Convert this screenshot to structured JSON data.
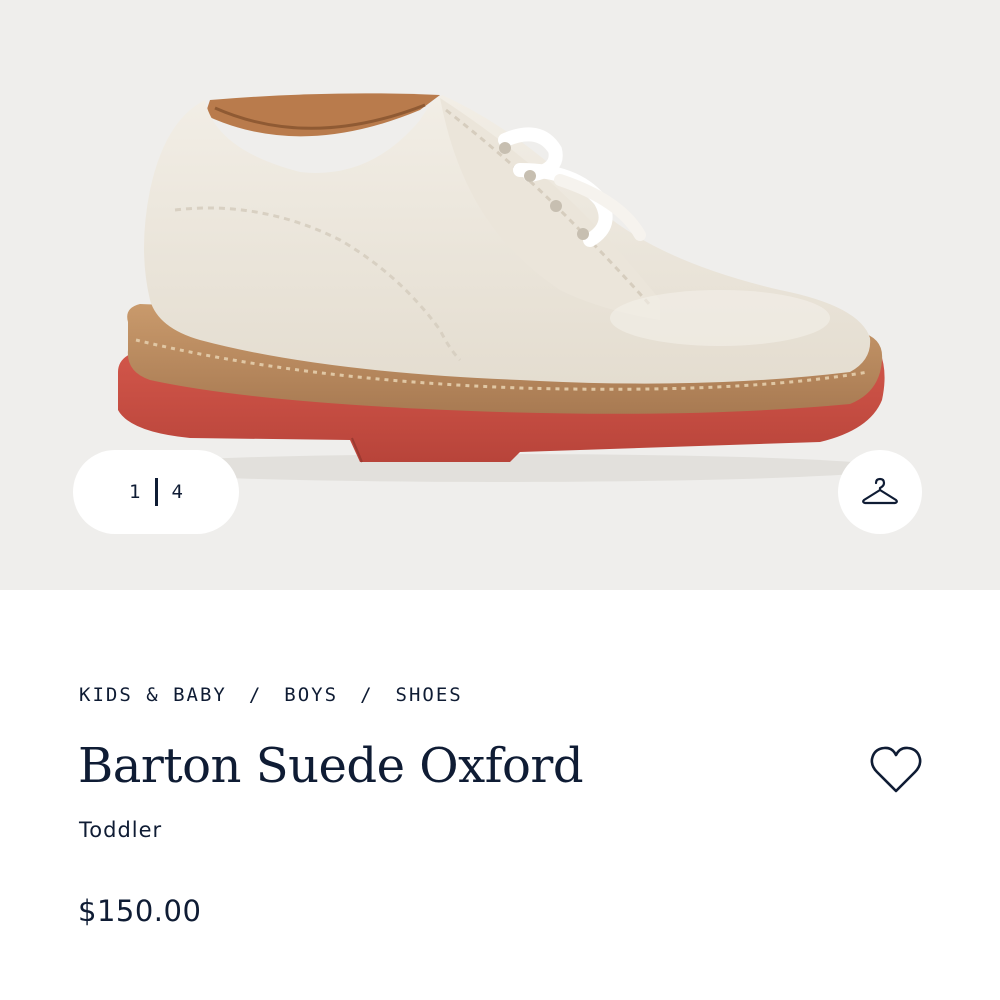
{
  "gallery": {
    "current_index": "1",
    "total_count": "4",
    "image_alt": "Barton Suede Oxford"
  },
  "breadcrumb": {
    "items": [
      "KIDS & BABY",
      "BOYS",
      "SHOES"
    ],
    "separator": "/"
  },
  "product": {
    "name": "Barton Suede Oxford",
    "size_group": "Toddler",
    "price": "$150.00"
  },
  "icons": {
    "fit": "hanger-icon",
    "wishlist": "heart-icon"
  },
  "colors": {
    "text": "#0f1c34",
    "gallery_bg": "#efeeec",
    "shoe_upper": "#ece6dc",
    "sole": "#c8493d"
  }
}
